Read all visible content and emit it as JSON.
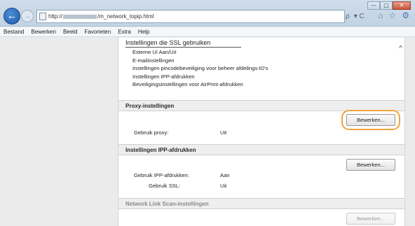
{
  "browser": {
    "url_prefix": "http://",
    "url_suffix": "/m_network_topip.html",
    "search_icon_text": "ρ",
    "lock_icon_text": "▾ C",
    "tool_icons": [
      "⌂",
      "☆",
      "⚙"
    ],
    "window_buttons": [
      "—",
      "▢",
      "✕"
    ],
    "back_arrow": "←",
    "forward_arrow": "→"
  },
  "menu": [
    "Bestand",
    "Bewerken",
    "Beeld",
    "Favorieten",
    "Extra",
    "Help"
  ],
  "ssl": {
    "heading": "Instellingen die SSL gebruiken",
    "items": [
      "Externe UI Aan/Uit",
      "E-mailinstellingen",
      "Instellingen pincodebeveiliging voor beheer afdelings-ID's",
      "Instellingen IPP-afdrukken",
      "Beveiligingsinstellingen voor AirPrint-afdrukken"
    ]
  },
  "proxy": {
    "title": "Proxy-instellingen",
    "edit_label": "Bewerken...",
    "use_label": "Gebruik proxy:",
    "use_value": "Uit"
  },
  "ipp": {
    "title": "Instellingen IPP-afdrukken",
    "edit_label": "Bewerken...",
    "use_label": "Gebruik IPP-afdrukken:",
    "use_value": "Aan",
    "ssl_label": "Gebruik SSL:",
    "ssl_value": "Uit"
  },
  "network_link": {
    "title": "Network Link Scan-instellingen",
    "edit_label": "Bewerken..."
  },
  "colors": {
    "highlight": "#f2a43a",
    "back_button": "#1e5aa8"
  }
}
